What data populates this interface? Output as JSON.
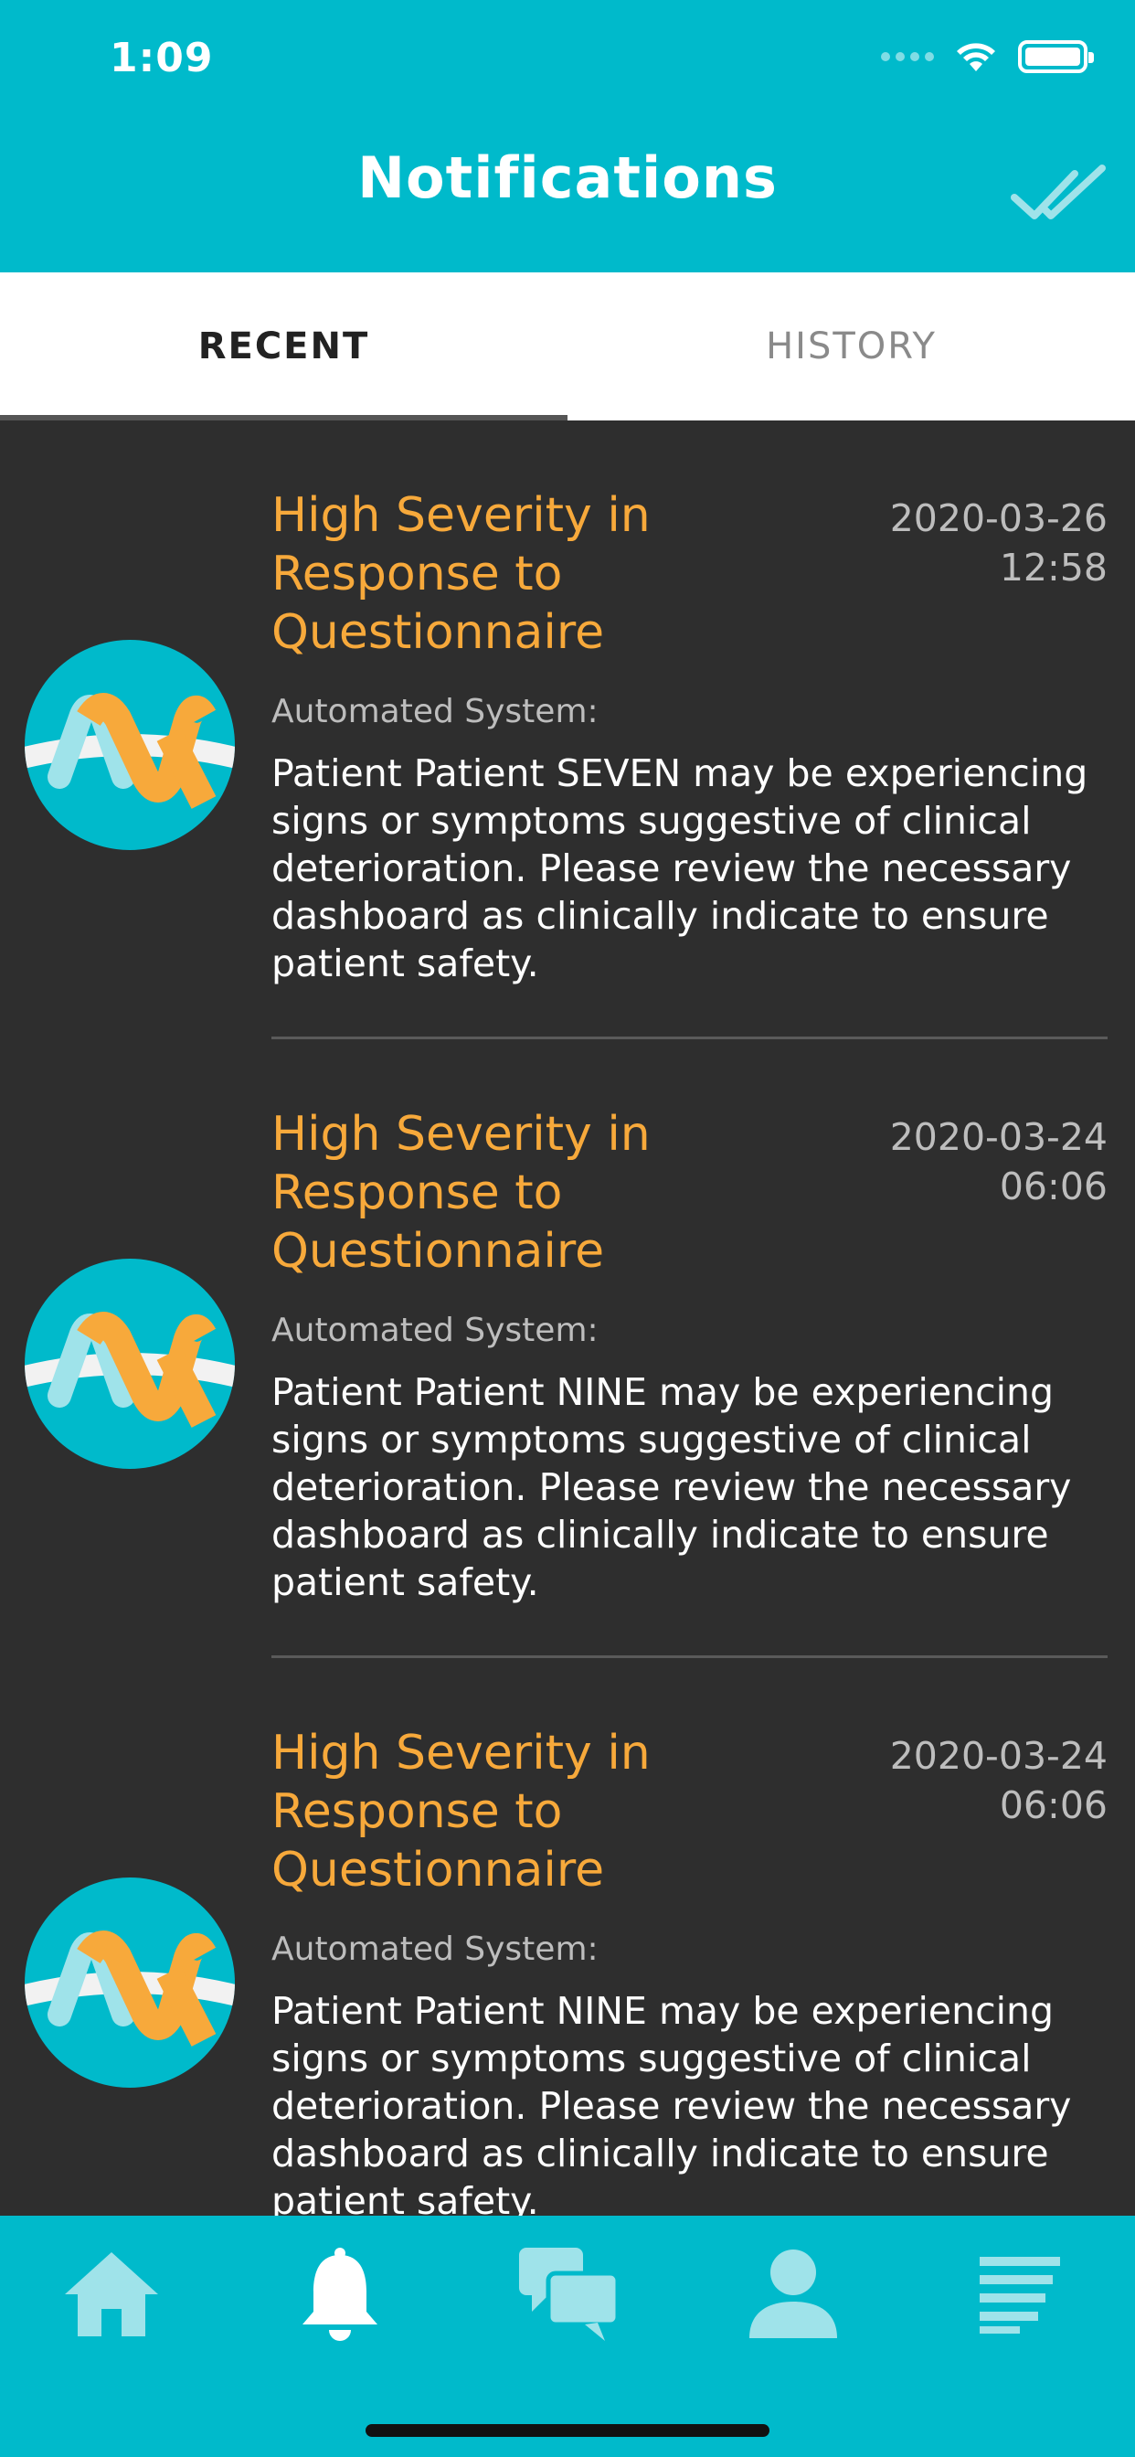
{
  "status_bar": {
    "time": "1:09"
  },
  "header": {
    "title": "Notifications",
    "mark_all_icon": "double-check-icon"
  },
  "tabs": [
    {
      "label": "RECENT",
      "active": true
    },
    {
      "label": "HISTORY",
      "active": false
    }
  ],
  "notifications": [
    {
      "title": "High Severity in Response to Questionnaire",
      "date": "2020-03-26\n12:58",
      "sender": "Automated System:",
      "body": "Patient Patient SEVEN may be experiencing signs or symptoms suggestive of clinical deterioration. Please review the necessary dashboard as clinically indicate to ensure patient safety."
    },
    {
      "title": "High Severity in Response to Questionnaire",
      "date": "2020-03-24\n06:06",
      "sender": "Automated System:",
      "body": "Patient Patient NINE may be experiencing signs or symptoms suggestive of clinical deterioration. Please review the necessary dashboard as clinically indicate to ensure patient safety."
    },
    {
      "title": "High Severity in Response to Questionnaire",
      "date": "2020-03-24\n06:06",
      "sender": "Automated System:",
      "body": "Patient Patient NINE may be experiencing signs or symptoms suggestive of clinical deterioration. Please review the necessary dashboard as clinically indicate to ensure patient safety."
    }
  ],
  "bottom_nav": [
    {
      "icon": "home-icon",
      "active": false
    },
    {
      "icon": "bell-icon",
      "active": true
    },
    {
      "icon": "chat-icon",
      "active": false
    },
    {
      "icon": "person-icon",
      "active": false
    },
    {
      "icon": "menu-icon",
      "active": false
    }
  ],
  "colors": {
    "brand": "#00bacb",
    "title_accent": "#f7a93b",
    "list_bg": "#2e2e2e",
    "inactive_icon": "#9fe3ea"
  }
}
